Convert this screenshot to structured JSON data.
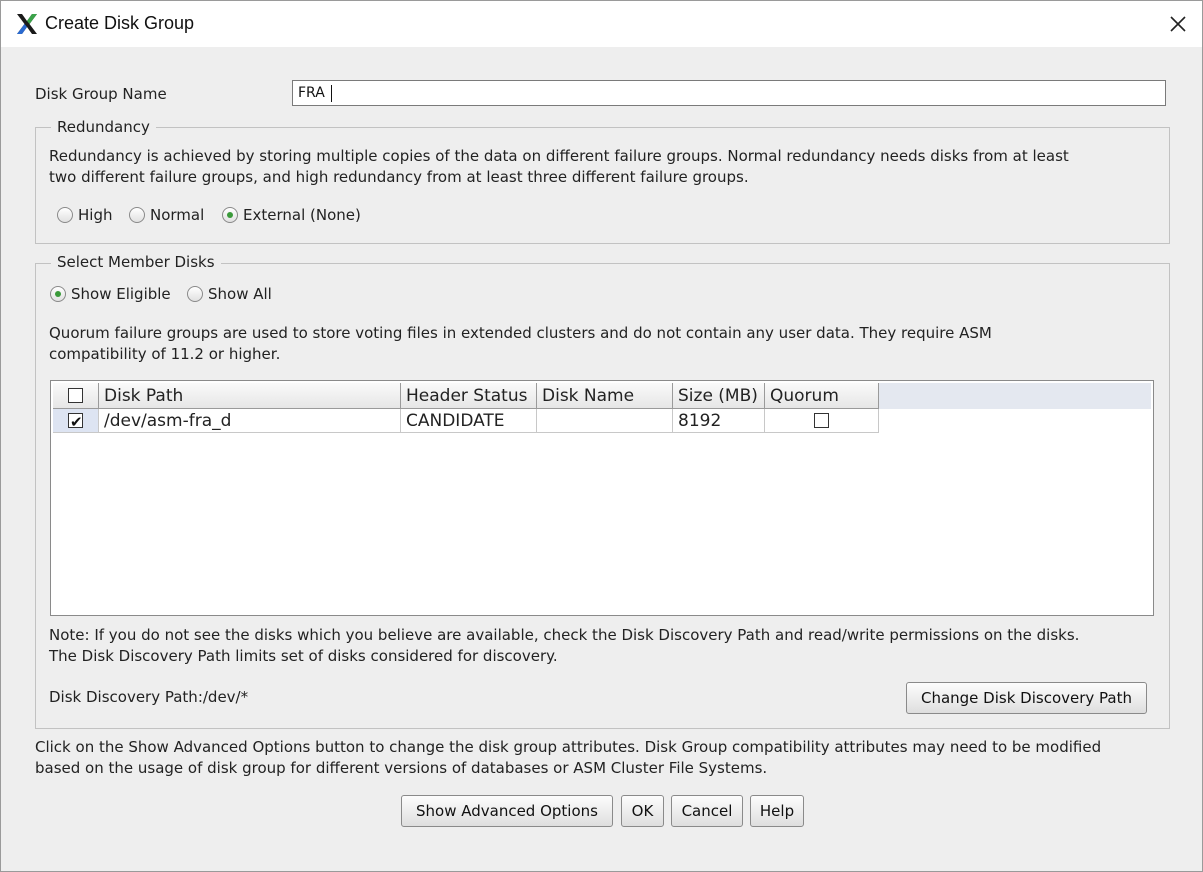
{
  "window": {
    "title": "Create Disk Group",
    "icon": "x-app-icon"
  },
  "disk_group_name": {
    "label": "Disk Group Name",
    "value": "FRA"
  },
  "redundancy": {
    "legend": "Redundancy",
    "description_line1": "Redundancy is achieved by storing multiple copies of the data on different failure groups. Normal redundancy needs disks from at least",
    "description_line2": "two different failure groups, and high redundancy from at least three different failure groups.",
    "options": [
      {
        "label": "High",
        "selected": false
      },
      {
        "label": "Normal",
        "selected": false
      },
      {
        "label": "External (None)",
        "selected": true
      }
    ]
  },
  "member_disks": {
    "legend": "Select Member Disks",
    "filters": [
      {
        "label": "Show Eligible",
        "selected": true
      },
      {
        "label": "Show All",
        "selected": false
      }
    ],
    "quorum_note_line1": "Quorum failure groups are used to store voting files in extended clusters and do not contain any user data. They require ASM",
    "quorum_note_line2": "compatibility of 11.2 or higher.",
    "table": {
      "columns": [
        "Disk Path",
        "Header Status",
        "Disk Name",
        "Size (MB)",
        "Quorum"
      ],
      "select_all_checked": false,
      "rows": [
        {
          "selected": true,
          "disk_path": "/dev/asm-fra_d",
          "header_status": "CANDIDATE",
          "disk_name": "",
          "size_mb": "8192",
          "quorum": false
        }
      ]
    },
    "discovery_note_line1": "Note: If you do not see the disks which you believe are available, check the Disk Discovery Path and read/write permissions on the disks.",
    "discovery_note_line2": "The Disk Discovery Path limits set of disks considered for discovery.",
    "discovery_path": "Disk Discovery Path:/dev/*",
    "change_path_button": "Change Disk Discovery Path"
  },
  "advanced_note_line1": "Click on the Show Advanced Options button to change the disk group attributes. Disk Group compatibility attributes may need to be modified",
  "advanced_note_line2": "based on the usage of disk group for different versions of databases or ASM Cluster File Systems.",
  "buttons": {
    "advanced": "Show Advanced Options",
    "ok": "OK",
    "cancel": "Cancel",
    "help": "Help"
  },
  "colors": {
    "radio_selected": "#3a9a3a",
    "title_bar": "#ffffff",
    "dialog_bg": "#eeeeee"
  }
}
